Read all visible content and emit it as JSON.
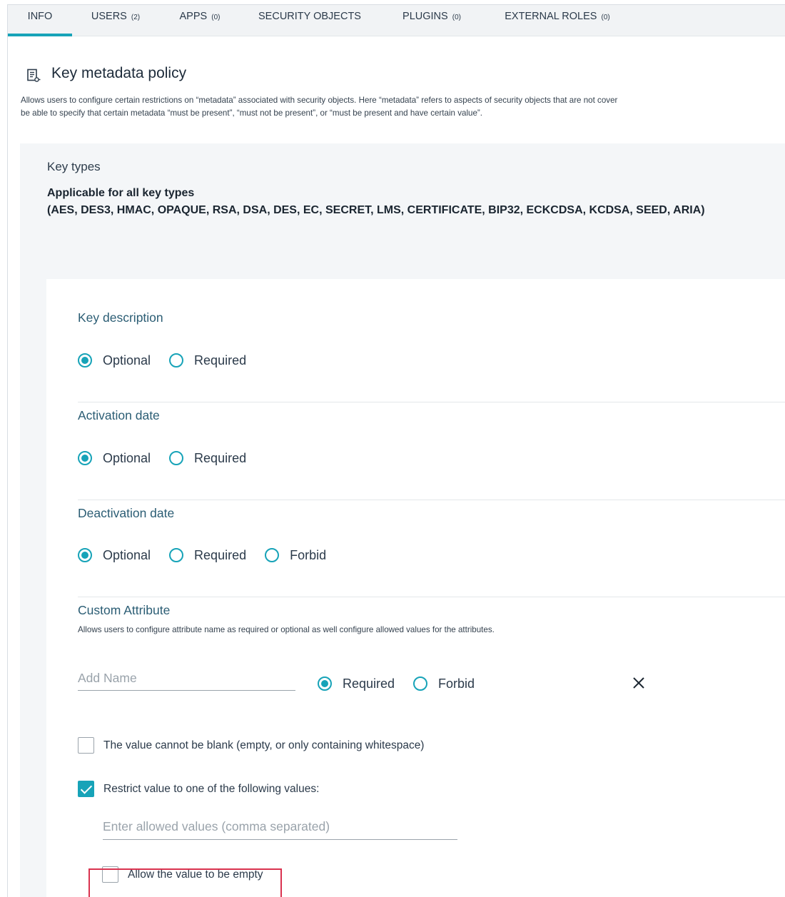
{
  "tabs": [
    {
      "label": "INFO",
      "count": ""
    },
    {
      "label": "USERS",
      "count": "(2)"
    },
    {
      "label": "APPS",
      "count": "(0)"
    },
    {
      "label": "SECURITY OBJECTS",
      "count": ""
    },
    {
      "label": "PLUGINS",
      "count": "(0)"
    },
    {
      "label": "EXTERNAL ROLES",
      "count": "(0)"
    }
  ],
  "active_tab": "INFO",
  "header": {
    "title": "Key metadata policy",
    "icon": "document-key-icon",
    "description_line1": "Allows users to configure certain restrictions on “metadata” associated with security objects. Here “metadata” refers to aspects of security objects that are not cover",
    "description_line2": "be able to specify that certain metadata “must be present”, “must not be present”, or “must be present and have certain value”."
  },
  "key_types": {
    "title": "Key types",
    "heading": "Applicable for all key types",
    "list": "(AES, DES3, HMAC, OPAQUE, RSA, DSA, DES, EC, SECRET, LMS, CERTIFICATE, BIP32, ECKCDSA, KCDSA, SEED, ARIA)"
  },
  "sections": {
    "key_description": {
      "title": "Key description",
      "opt1": "Optional",
      "opt2": "Required",
      "selected": "Optional"
    },
    "activation_date": {
      "title": "Activation date",
      "opt1": "Optional",
      "opt2": "Required",
      "selected": "Optional"
    },
    "deactivation_date": {
      "title": "Deactivation date",
      "opt1": "Optional",
      "opt2": "Required",
      "opt3": "Forbid",
      "selected": "Optional"
    }
  },
  "custom_attribute": {
    "title": "Custom Attribute",
    "description": "Allows users to configure attribute name as required or optional as well configure allowed values for the attributes.",
    "name_placeholder": "Add Name",
    "name_value": "",
    "opt1": "Required",
    "opt2": "Forbid",
    "selected": "Required",
    "not_blank_label": "The value cannot be blank (empty, or only containing whitespace)",
    "not_blank_checked": false,
    "restrict_label": "Restrict value to one of the following values:",
    "restrict_checked": true,
    "allowed_placeholder": "Enter allowed values (comma separated)",
    "allow_empty_label": "Allow the value to be empty",
    "allow_empty_checked": false
  },
  "colors": {
    "accent": "#17a3b8",
    "highlight": "#d9324f",
    "panel_bg": "#f4f6f8"
  }
}
